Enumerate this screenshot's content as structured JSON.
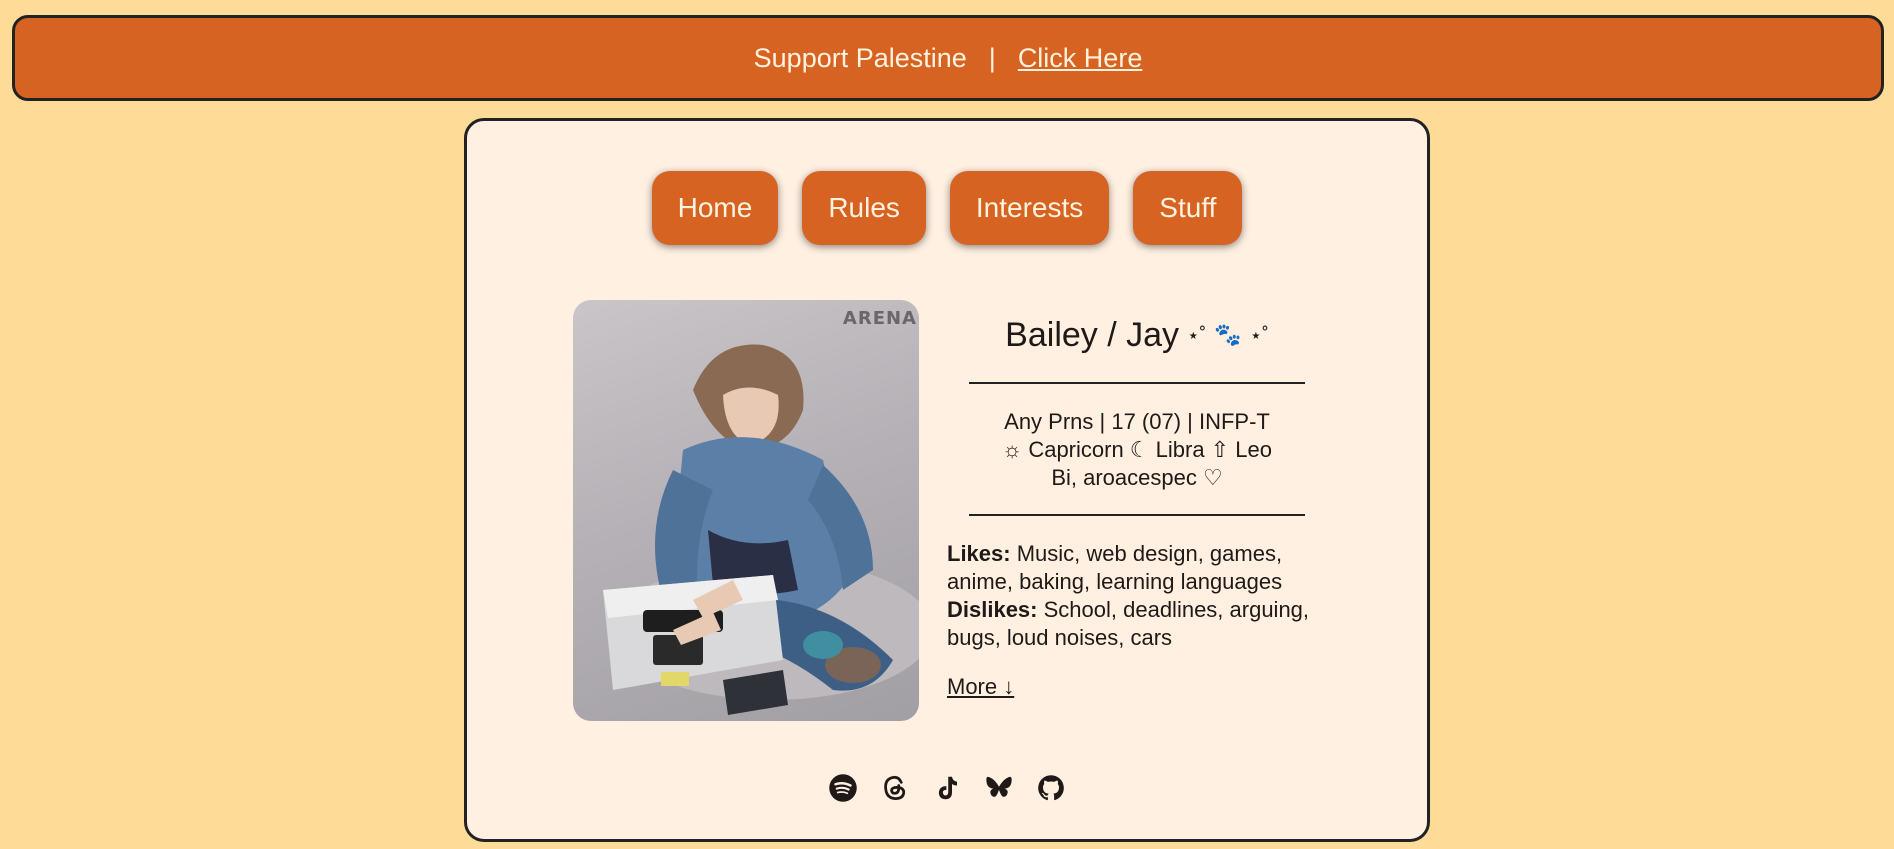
{
  "banner": {
    "text": "Support Palestine",
    "separator": "|",
    "link_label": "Click Here"
  },
  "nav": {
    "items": [
      {
        "label": "Home"
      },
      {
        "label": "Rules"
      },
      {
        "label": "Interests"
      },
      {
        "label": "Stuff"
      }
    ]
  },
  "profile": {
    "photo_watermark": "ARENA",
    "name": "Bailey / Jay",
    "name_deco_left": "⋆˚",
    "name_deco_paw": "🐾",
    "name_deco_right": "⋆˚",
    "stats_line1": "Any Prns | 17 (07) | INFP-T",
    "stats_line2": "☼ Capricorn ☾ Libra ⇧ Leo",
    "stats_line3": "Bi, aroacespec ♡",
    "likes_label": "Likes:",
    "likes_text": "Music, web design, games, anime, baking, learning languages",
    "dislikes_label": "Dislikes:",
    "dislikes_text": "School, deadlines, arguing, bugs, loud noises, cars",
    "more_label": "More ↓"
  },
  "socials": [
    "spotify-icon",
    "threads-icon",
    "tiktok-icon",
    "bluesky-icon",
    "github-icon"
  ],
  "colors": {
    "background": "#fedc98",
    "accent": "#d66321",
    "card": "#fff0e2",
    "text": "#1f1a17"
  }
}
